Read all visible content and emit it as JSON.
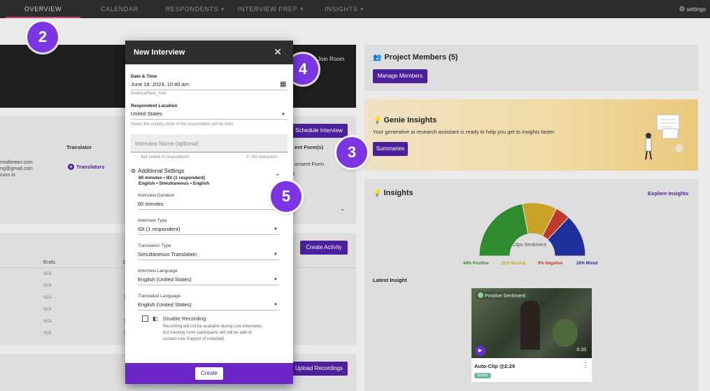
{
  "nav": {
    "tabs": [
      {
        "label": "OVERVIEW",
        "active": true
      },
      {
        "label": "CALENDAR"
      },
      {
        "label": "RESPONDENTS",
        "caret": "▼"
      },
      {
        "label": "INTERVIEW PREP",
        "caret": "▼"
      },
      {
        "label": "INSIGHTS",
        "caret": "▼"
      }
    ],
    "settings": "settings",
    "settings_icon": "gear-icon"
  },
  "badges": [
    "2",
    "4",
    "3",
    "5"
  ],
  "background": {
    "join_room": "Join Room",
    "schedule_interview": "Schedule Interview",
    "translator_header": "Translator",
    "consent_header": "ent Form(s)",
    "consent_link": "onsent Form",
    "partial_link": "t",
    "emails": [
      "moderator.com",
      "ng@gmail.com",
      "cuss.io"
    ],
    "translators_link": "Translators",
    "create_activity": "Create Activity",
    "ends_header": "Ends",
    "d_header": "D",
    "na_rows": [
      "N/A",
      "N/A",
      "N/A",
      "N/A",
      "N/A",
      "N/A"
    ],
    "one_marks": [
      "1",
      "1",
      "1"
    ],
    "upload_recordings": "Upload Recordings"
  },
  "project_members": {
    "title": "Project Members (5)",
    "manage": "Manage Members"
  },
  "genie": {
    "title": "Genie Insights",
    "desc": "Your generative ai research assistant is ready to help you get to insights faster.",
    "summaries": "Summaries"
  },
  "insights": {
    "title": "Insights",
    "explore": "Explore Insights",
    "latest": "Latest Insight",
    "chart_label": "Clips Sentiment",
    "legend": [
      {
        "text": "44% Positive",
        "color": "#2e8b2e"
      },
      {
        "text": "21% Neutral",
        "color": "#c9a227"
      },
      {
        "text": "9% Negative",
        "color": "#c0392b"
      },
      {
        "text": "26% Mixed",
        "color": "#1f2f9a"
      }
    ],
    "sentiment": [
      {
        "name": "Positive",
        "value": 44,
        "color": "#2e8b2e"
      },
      {
        "name": "Neutral",
        "value": 21,
        "color": "#c9a227"
      },
      {
        "name": "Negative",
        "value": 9,
        "color": "#c0392b"
      },
      {
        "name": "Mixed",
        "value": 26,
        "color": "#1f2f9a"
      }
    ],
    "clip_badge": "Positive Sentiment",
    "clip_time": "0:33",
    "clip_title": "Auto-Clip @2:29",
    "clip_tag": "Water"
  },
  "modal": {
    "title": "New Interview",
    "date_label": "Date & Time",
    "date_value": "June 18, 2024, 10:40 am",
    "timezone": "America/New_York",
    "location_label": "Respondent Location",
    "location_value": "United States",
    "location_hint": "Select the country most of the respondents will be from",
    "name_placeholder": "Interview Name (optional)",
    "visibility_hint": "Not visible to respondents",
    "char_count": "0 / 50 characters",
    "additional_title": "Additional Settings",
    "additional_line1": "60 minutes • IDI (1 respondent)",
    "additional_line2": "English • Simultaneous • English",
    "duration_label": "Interview Duration",
    "duration_value": "60 minutes",
    "type_label": "Interview Type",
    "type_value": "IDI (1 respondent)",
    "translation_label": "Translation Type",
    "translation_value": "Simultaneous Translation",
    "language_label": "Interview Language",
    "language_value": "English (United States)",
    "translated_label": "Translated Language",
    "translated_value": "English (United States)",
    "disable_label": "Disable Recording",
    "disable_desc1": "Recording will not be available during Live Interviews,",
    "disable_desc2": "but meeting room participants will still be able to",
    "disable_desc3": "contact Live Support (if included).",
    "create": "Create"
  }
}
